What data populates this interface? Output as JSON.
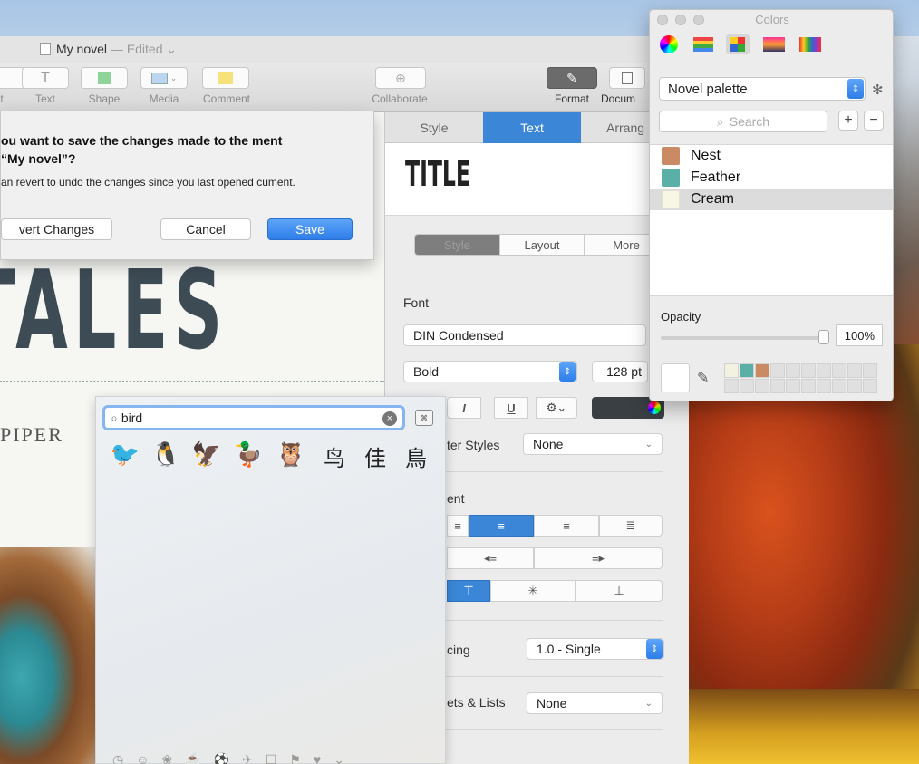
{
  "document": {
    "title": "My novel",
    "separator": " — ",
    "edited": "Edited",
    "big_title": "TALES",
    "subtitle": "PIPER"
  },
  "toolbar": {
    "items": [
      {
        "label": "t"
      },
      {
        "label": "Text"
      },
      {
        "label": "Shape"
      },
      {
        "label": "Media"
      },
      {
        "label": "Comment"
      },
      {
        "label": "Collaborate"
      },
      {
        "label": "Format"
      },
      {
        "label": "Docum"
      }
    ]
  },
  "save_dialog": {
    "heading": "ou want to save the changes made to the ment “My novel”?",
    "body": "an revert to undo the changes since you last opened cument.",
    "revert_label": "vert Changes",
    "cancel_label": "Cancel",
    "save_label": "Save"
  },
  "inspector": {
    "tabs": [
      "Style",
      "Text",
      "Arrang"
    ],
    "active_tab": "Text",
    "style_preview": "TITLE",
    "segments": [
      "Style",
      "Layout",
      "More"
    ],
    "font_section": "Font",
    "font_family": "DIN Condensed",
    "font_style": "Bold",
    "font_size": "128 pt",
    "format_buttons": [
      "I",
      "U"
    ],
    "char_styles_label": "ter Styles",
    "char_styles_value": "None",
    "alignment_label": "ent",
    "spacing_label": "cing",
    "spacing_value": "1.0 - Single",
    "bullets_label": "ets & Lists",
    "bullets_value": "None"
  },
  "emoji_picker": {
    "search_value": "bird",
    "results": [
      "🐦",
      "🐧",
      "🦅",
      "🦆",
      "🦉"
    ],
    "cjk_results": [
      "鸟",
      "佳",
      "鳥"
    ]
  },
  "colors_panel": {
    "title": "Colors",
    "palette": "Novel palette",
    "search_placeholder": "Search",
    "add": "+",
    "remove": "−",
    "colors": [
      {
        "name": "Nest",
        "hex": "#c98a64",
        "selected": false
      },
      {
        "name": "Feather",
        "hex": "#5ab0a6",
        "selected": false
      },
      {
        "name": "Cream",
        "hex": "#f8f6e4",
        "selected": true
      }
    ],
    "opacity_label": "Opacity",
    "opacity_value": "100%",
    "opacity": 1.0,
    "saved_swatches": [
      "#f3f1e0",
      "#5ab0a6",
      "#c98a64"
    ]
  },
  "colors": {
    "accent": "#3b86d6",
    "text_color_well": "#3a3f44"
  }
}
